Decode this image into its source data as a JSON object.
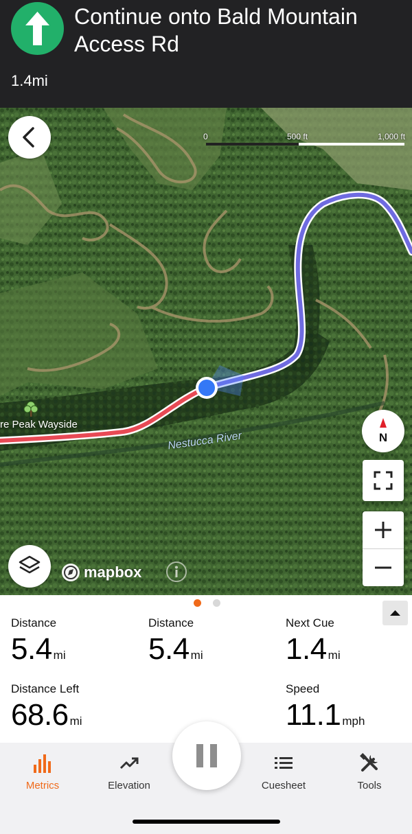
{
  "navigation": {
    "instruction": "Continue onto Bald Mountain Access Rd",
    "distance": "1.4mi",
    "turn_icon": "arrow-up-icon",
    "accent_color": "#22b06a"
  },
  "map": {
    "scale": {
      "label_0": "0",
      "label_mid": "500 ft",
      "label_max": "1,000 ft"
    },
    "place_label": "re Peak Wayside",
    "river_label": "Nestucca River",
    "compass_label": "N",
    "attribution": "mapbox",
    "route_color_done": "#e84a55",
    "route_color_ahead": "#6f6be0"
  },
  "metrics": {
    "items": [
      {
        "label": "Distance",
        "value": "5.4",
        "unit": "mi"
      },
      {
        "label": "Distance",
        "value": "5.4",
        "unit": "mi"
      },
      {
        "label": "Next Cue",
        "value": "1.4",
        "unit": "mi"
      },
      {
        "label": "Distance Left",
        "value": "68.6",
        "unit": "mi"
      },
      {
        "label": "Speed",
        "value": "11.1",
        "unit": "mph"
      }
    ],
    "active_page": 1,
    "page_count": 2,
    "accent_color": "#f06a1a"
  },
  "tabs": {
    "metrics": "Metrics",
    "elevation": "Elevation",
    "cuesheet": "Cuesheet",
    "tools": "Tools",
    "active": "metrics"
  }
}
